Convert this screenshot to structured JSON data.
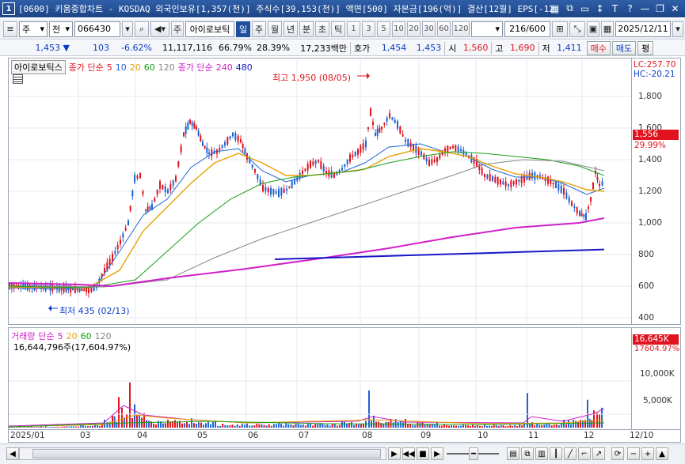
{
  "window": {
    "number": "1",
    "title": "[0600] 키움종합차트 - KOSDAQ 외국인보유[1,357(천)] 주식수[39,153(천)] 액면[500] 자본금[196(억)] 결산[12월] EPS[-12"
  },
  "toolbar": {
    "type_label": "주",
    "prev_label": "전",
    "code": "066430",
    "stock_badge": "주",
    "stock_name": "아이로보틱",
    "period_tabs": [
      "일",
      "주",
      "월",
      "년",
      "분",
      "초",
      "틱"
    ],
    "active_period": "일",
    "intervals": [
      "1",
      "3",
      "5",
      "10",
      "20",
      "30",
      "60",
      "120"
    ],
    "count": "216/600",
    "date": "2025/12/11"
  },
  "quote": {
    "price": "1,453",
    "change_arrow": "▼",
    "change": "103",
    "change_pct": "-6.62%",
    "volume": "11,117,116",
    "vol_pct": "66.79%",
    "turnover_pct": "28.39%",
    "amount": "17,233백만",
    "hoga_label": "호가",
    "bid": "1,454",
    "ask": "1,453",
    "open_label": "시",
    "open": "1,560",
    "high_label": "고",
    "high": "1,690",
    "low_label": "저",
    "low": "1,411",
    "buy_label": "매수",
    "sell_label": "매도",
    "eval_label": "평"
  },
  "legend": {
    "name": "아이로보틱스",
    "ma_label": "종가 단순",
    "ma_periods": [
      "5",
      "10",
      "20",
      "60",
      "120"
    ],
    "ma_colors": [
      "#e0141e",
      "#1e64d2",
      "#e8a000",
      "#18a018",
      "#888888"
    ],
    "ma2_label": "종가 단순",
    "ma2_periods": [
      "240",
      "480"
    ],
    "ma2_colors": [
      "#d020c8",
      "#1818c8"
    ]
  },
  "annotations": {
    "high_text": "최고 1,950 (08/05)",
    "low_text": "최저 435 (02/13)"
  },
  "price_axis": {
    "lc": "LC:257.70",
    "hc": "HC:-20.21",
    "ticks": [
      "1,800",
      "1,600",
      "1,400",
      "1,200",
      "1,000",
      "800",
      "600",
      "400"
    ],
    "current_tag": "1,556",
    "current_pct": "29.99%"
  },
  "volume_legend": {
    "label": "거래량",
    "ma_label": "단순",
    "periods": [
      "5",
      "20",
      "60",
      "120"
    ],
    "colors": [
      "#d020c8",
      "#e8a000",
      "#18a018",
      "#888888"
    ],
    "value": "16,644,796주(17,604.97%)"
  },
  "volume_axis": {
    "current_tag": "16,645K",
    "current_pct": "17604.97%",
    "ticks": [
      "10,000K",
      "5,000K"
    ]
  },
  "x_axis": {
    "labels": [
      "2025/01",
      "03",
      "04",
      "05",
      "06",
      "07",
      "08",
      "09",
      "10",
      "11",
      "12",
      "12/10"
    ]
  },
  "bottom_bar": {
    "buttons": [
      "◀",
      "▶",
      "◀◀",
      "■",
      "▶",
      "━",
      "+",
      "▲"
    ]
  }
}
